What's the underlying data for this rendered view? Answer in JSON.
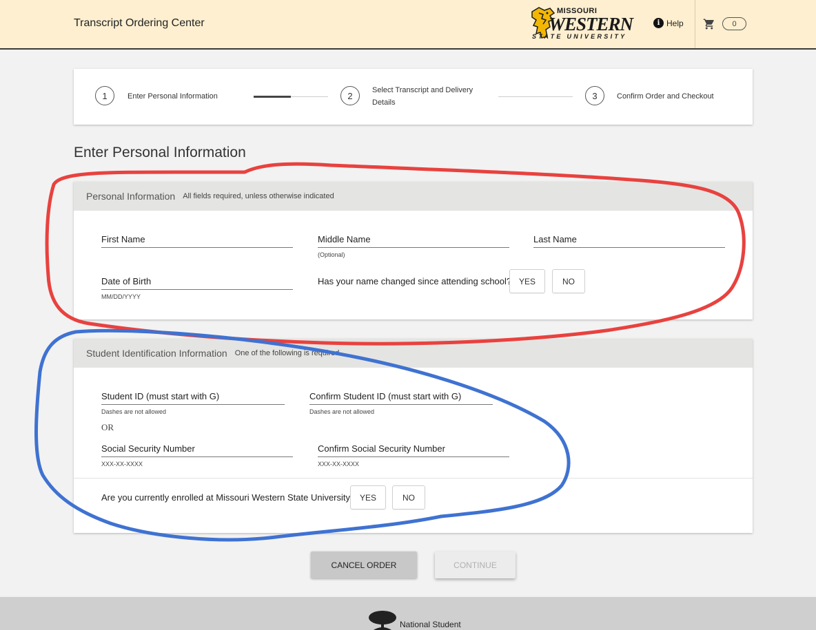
{
  "header": {
    "app_title": "Transcript Ordering Center",
    "logo": {
      "line1": "MISSOURI",
      "line2": "WESTERN",
      "line3": "STATE UNIVERSITY",
      "icon": "griffin-logo"
    },
    "help_label": "Help",
    "help_icon": "info-icon",
    "cart_icon": "cart-icon",
    "cart_count": "0"
  },
  "stepper": {
    "steps": [
      {
        "number": "1",
        "label": "Enter Personal Information"
      },
      {
        "number": "2",
        "label_line1": "Select Transcript and Delivery",
        "label_line2": "Details"
      },
      {
        "number": "3",
        "label": "Confirm Order and Checkout"
      }
    ],
    "progress": 0.5
  },
  "page_title": "Enter Personal Information",
  "personal_info": {
    "title": "Personal Information",
    "subtitle": "All fields required, unless otherwise indicated",
    "first_name": {
      "label": "First Name"
    },
    "middle_name": {
      "label": "Middle Name",
      "hint": "(Optional)"
    },
    "last_name": {
      "label": "Last Name"
    },
    "date_of_birth": {
      "label": "Date of Birth",
      "hint": "MM/DD/YYYY"
    },
    "name_changed": {
      "question": "Has your name changed since attending school?",
      "yes": "YES",
      "no": "NO"
    }
  },
  "student_id_info": {
    "title": "Student Identification Information",
    "subtitle": "One of the following is required",
    "student_id": {
      "label": "Student ID (must start with G)",
      "hint": "Dashes are not allowed"
    },
    "confirm_student_id": {
      "label": "Confirm Student ID (must start with G)",
      "hint": "Dashes are not allowed"
    },
    "or_text": "OR",
    "ssn": {
      "label": "Social Security Number",
      "hint": "XXX-XX-XXXX"
    },
    "confirm_ssn": {
      "label": "Confirm Social Security Number",
      "hint": "XXX-XX-XXXX"
    },
    "enrolled": {
      "question": "Are you currently enrolled at Missouri Western State University?",
      "yes": "YES",
      "no": "NO"
    }
  },
  "actions": {
    "cancel": "CANCEL ORDER",
    "continue": "CONTINUE"
  },
  "footer": {
    "text": "National Student",
    "icon": "tree-icon"
  },
  "annotation_colors": {
    "red": "#e8423f",
    "blue": "#3f72d1"
  }
}
